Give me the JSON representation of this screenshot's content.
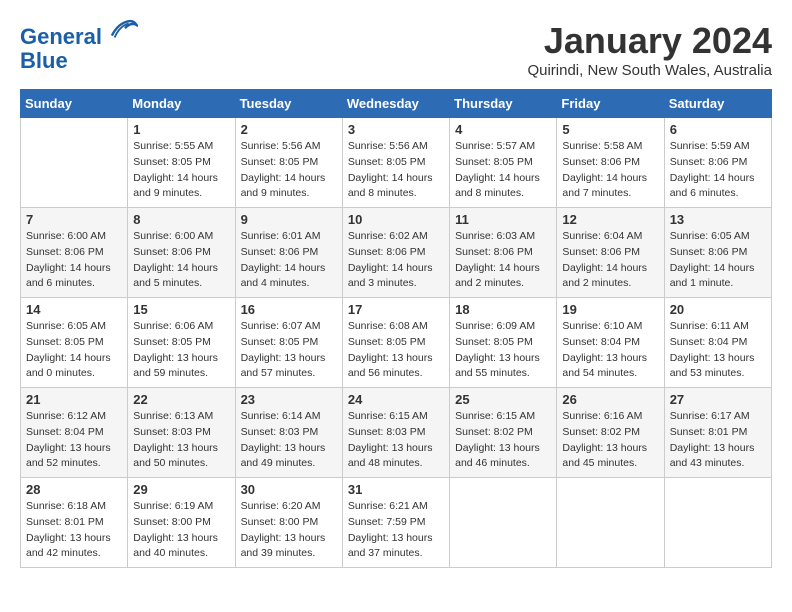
{
  "header": {
    "logo_line1": "General",
    "logo_line2": "Blue",
    "month_title": "January 2024",
    "location": "Quirindi, New South Wales, Australia"
  },
  "days_of_week": [
    "Sunday",
    "Monday",
    "Tuesday",
    "Wednesday",
    "Thursday",
    "Friday",
    "Saturday"
  ],
  "weeks": [
    [
      {
        "day": "",
        "info": ""
      },
      {
        "day": "1",
        "info": "Sunrise: 5:55 AM\nSunset: 8:05 PM\nDaylight: 14 hours\nand 9 minutes."
      },
      {
        "day": "2",
        "info": "Sunrise: 5:56 AM\nSunset: 8:05 PM\nDaylight: 14 hours\nand 9 minutes."
      },
      {
        "day": "3",
        "info": "Sunrise: 5:56 AM\nSunset: 8:05 PM\nDaylight: 14 hours\nand 8 minutes."
      },
      {
        "day": "4",
        "info": "Sunrise: 5:57 AM\nSunset: 8:05 PM\nDaylight: 14 hours\nand 8 minutes."
      },
      {
        "day": "5",
        "info": "Sunrise: 5:58 AM\nSunset: 8:06 PM\nDaylight: 14 hours\nand 7 minutes."
      },
      {
        "day": "6",
        "info": "Sunrise: 5:59 AM\nSunset: 8:06 PM\nDaylight: 14 hours\nand 6 minutes."
      }
    ],
    [
      {
        "day": "7",
        "info": "Sunrise: 6:00 AM\nSunset: 8:06 PM\nDaylight: 14 hours\nand 6 minutes."
      },
      {
        "day": "8",
        "info": "Sunrise: 6:00 AM\nSunset: 8:06 PM\nDaylight: 14 hours\nand 5 minutes."
      },
      {
        "day": "9",
        "info": "Sunrise: 6:01 AM\nSunset: 8:06 PM\nDaylight: 14 hours\nand 4 minutes."
      },
      {
        "day": "10",
        "info": "Sunrise: 6:02 AM\nSunset: 8:06 PM\nDaylight: 14 hours\nand 3 minutes."
      },
      {
        "day": "11",
        "info": "Sunrise: 6:03 AM\nSunset: 8:06 PM\nDaylight: 14 hours\nand 2 minutes."
      },
      {
        "day": "12",
        "info": "Sunrise: 6:04 AM\nSunset: 8:06 PM\nDaylight: 14 hours\nand 2 minutes."
      },
      {
        "day": "13",
        "info": "Sunrise: 6:05 AM\nSunset: 8:06 PM\nDaylight: 14 hours\nand 1 minute."
      }
    ],
    [
      {
        "day": "14",
        "info": "Sunrise: 6:05 AM\nSunset: 8:05 PM\nDaylight: 14 hours\nand 0 minutes."
      },
      {
        "day": "15",
        "info": "Sunrise: 6:06 AM\nSunset: 8:05 PM\nDaylight: 13 hours\nand 59 minutes."
      },
      {
        "day": "16",
        "info": "Sunrise: 6:07 AM\nSunset: 8:05 PM\nDaylight: 13 hours\nand 57 minutes."
      },
      {
        "day": "17",
        "info": "Sunrise: 6:08 AM\nSunset: 8:05 PM\nDaylight: 13 hours\nand 56 minutes."
      },
      {
        "day": "18",
        "info": "Sunrise: 6:09 AM\nSunset: 8:05 PM\nDaylight: 13 hours\nand 55 minutes."
      },
      {
        "day": "19",
        "info": "Sunrise: 6:10 AM\nSunset: 8:04 PM\nDaylight: 13 hours\nand 54 minutes."
      },
      {
        "day": "20",
        "info": "Sunrise: 6:11 AM\nSunset: 8:04 PM\nDaylight: 13 hours\nand 53 minutes."
      }
    ],
    [
      {
        "day": "21",
        "info": "Sunrise: 6:12 AM\nSunset: 8:04 PM\nDaylight: 13 hours\nand 52 minutes."
      },
      {
        "day": "22",
        "info": "Sunrise: 6:13 AM\nSunset: 8:03 PM\nDaylight: 13 hours\nand 50 minutes."
      },
      {
        "day": "23",
        "info": "Sunrise: 6:14 AM\nSunset: 8:03 PM\nDaylight: 13 hours\nand 49 minutes."
      },
      {
        "day": "24",
        "info": "Sunrise: 6:15 AM\nSunset: 8:03 PM\nDaylight: 13 hours\nand 48 minutes."
      },
      {
        "day": "25",
        "info": "Sunrise: 6:15 AM\nSunset: 8:02 PM\nDaylight: 13 hours\nand 46 minutes."
      },
      {
        "day": "26",
        "info": "Sunrise: 6:16 AM\nSunset: 8:02 PM\nDaylight: 13 hours\nand 45 minutes."
      },
      {
        "day": "27",
        "info": "Sunrise: 6:17 AM\nSunset: 8:01 PM\nDaylight: 13 hours\nand 43 minutes."
      }
    ],
    [
      {
        "day": "28",
        "info": "Sunrise: 6:18 AM\nSunset: 8:01 PM\nDaylight: 13 hours\nand 42 minutes."
      },
      {
        "day": "29",
        "info": "Sunrise: 6:19 AM\nSunset: 8:00 PM\nDaylight: 13 hours\nand 40 minutes."
      },
      {
        "day": "30",
        "info": "Sunrise: 6:20 AM\nSunset: 8:00 PM\nDaylight: 13 hours\nand 39 minutes."
      },
      {
        "day": "31",
        "info": "Sunrise: 6:21 AM\nSunset: 7:59 PM\nDaylight: 13 hours\nand 37 minutes."
      },
      {
        "day": "",
        "info": ""
      },
      {
        "day": "",
        "info": ""
      },
      {
        "day": "",
        "info": ""
      }
    ]
  ]
}
